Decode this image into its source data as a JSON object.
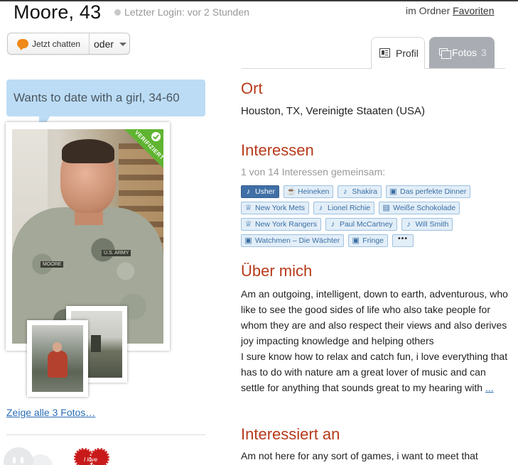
{
  "header": {
    "name_age": "Moore, 43",
    "last_login": "Letzter Login: vor 2 Stunden",
    "folder_prefix": "im Ordner",
    "folder_link": "Favoriten"
  },
  "actions": {
    "chat_label": "Jetzt chatten",
    "or_label": "oder"
  },
  "tabs": {
    "profile_label": "Profil",
    "photos_label": "Fotos",
    "photos_count": "3"
  },
  "left": {
    "wants_text": "Wants to date with a girl, 34-60",
    "verified_badge": "VERIFIZIERT",
    "photo_patch_name": "MOORE",
    "photo_patch_army": "U.S. ARMY",
    "show_all_photos": "Zeige alle 3 Fotos…",
    "heart_text": "I love"
  },
  "ort": {
    "heading": "Ort",
    "value": "Houston, TX, Vereinigte Staaten (USA)"
  },
  "interests": {
    "heading": "Interessen",
    "common_text": "1 von 14 Interessen gemeinsam:",
    "rows": [
      [
        {
          "label": "Usher",
          "icon": "music-note-icon",
          "highlight": true
        },
        {
          "label": "Heineken",
          "icon": "drink-icon"
        },
        {
          "label": "Shakira",
          "icon": "music-note-icon"
        },
        {
          "label": "Das perfekte Dinner",
          "icon": "tv-icon"
        }
      ],
      [
        {
          "label": "New York Mets",
          "icon": "trophy-icon"
        },
        {
          "label": "Lionel Richie",
          "icon": "music-note-icon"
        },
        {
          "label": "Weiße Schokolade",
          "icon": "food-icon"
        }
      ],
      [
        {
          "label": "New York Rangers",
          "icon": "trophy-icon"
        },
        {
          "label": "Paul McCartney",
          "icon": "music-note-icon"
        },
        {
          "label": "Will Smith",
          "icon": "music-note-icon"
        }
      ],
      [
        {
          "label": "Watchmen – Die Wächter",
          "icon": "tv-icon"
        },
        {
          "label": "Fringe",
          "icon": "tv-icon"
        }
      ]
    ],
    "more_label": "•••"
  },
  "about": {
    "heading": "Über mich",
    "text": "Am an outgoing, intelligent, down to earth, adventurous, who like to see the good sides of life who also take people for whom they are and also respect their views and also derives joy impacting knowledge and helping others\nI sure know how to relax and catch fun, i love everything that has to do with nature am a great lover of music and can settle for anything that sounds great to my hearing with",
    "more_link": "..."
  },
  "interested_in": {
    "heading": "Interessiert an",
    "text": "Am not here for any sort of games, i want to meet that"
  }
}
